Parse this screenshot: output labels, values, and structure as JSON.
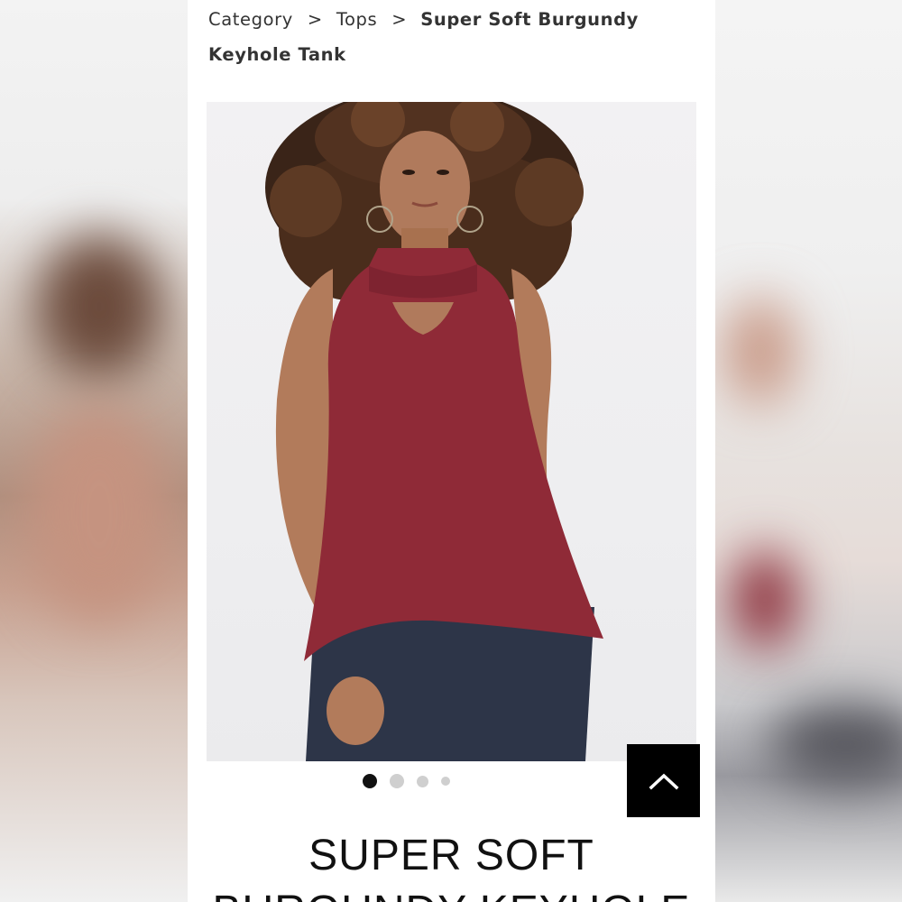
{
  "breadcrumb": {
    "items": [
      {
        "label": "Category"
      },
      {
        "label": "Tops"
      },
      {
        "label": "Super Soft Burgundy Keyhole Tank"
      }
    ],
    "separator": ">"
  },
  "product": {
    "image_alt": "Model wearing burgundy keyhole tank",
    "title": "SUPER SOFT BURGUNDY KEYHOLE",
    "top_color": "#8f2a37",
    "jeans_color": "#2d3548"
  },
  "carousel": {
    "count": 4,
    "active_index": 1
  },
  "icons": {
    "zoom_hint": "tap-to-zoom-icon",
    "back_to_top": "chevron-up-icon"
  }
}
